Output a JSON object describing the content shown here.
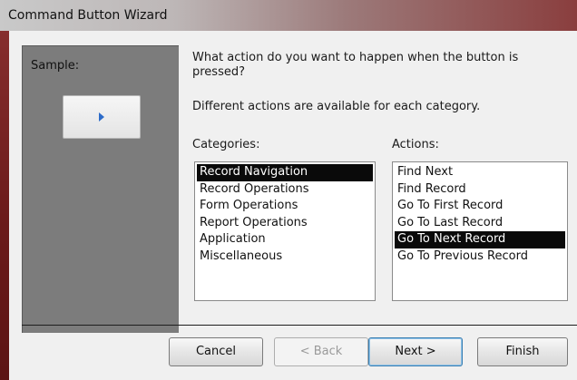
{
  "window": {
    "title": "Command Button Wizard"
  },
  "sample": {
    "label": "Sample:"
  },
  "prompt": {
    "question": "What action do you want to happen when the button is pressed?",
    "hint": "Different actions are available for each category."
  },
  "categories": {
    "label": "Categories:",
    "items": [
      {
        "label": "Record Navigation",
        "selected": true
      },
      {
        "label": "Record Operations",
        "selected": false
      },
      {
        "label": "Form Operations",
        "selected": false
      },
      {
        "label": "Report Operations",
        "selected": false
      },
      {
        "label": "Application",
        "selected": false
      },
      {
        "label": "Miscellaneous",
        "selected": false
      }
    ]
  },
  "actions": {
    "label": "Actions:",
    "items": [
      {
        "label": "Find Next",
        "selected": false
      },
      {
        "label": "Find Record",
        "selected": false
      },
      {
        "label": "Go To First Record",
        "selected": false
      },
      {
        "label": "Go To Last Record",
        "selected": false
      },
      {
        "label": "Go To Next Record",
        "selected": true
      },
      {
        "label": "Go To Previous Record",
        "selected": false
      }
    ]
  },
  "buttons": {
    "cancel": "Cancel",
    "back": "< Back",
    "next": "Next >",
    "finish": "Finish"
  },
  "colors": {
    "selection": "#0a0a0a",
    "sample_arrow": "#2d6cc9"
  }
}
